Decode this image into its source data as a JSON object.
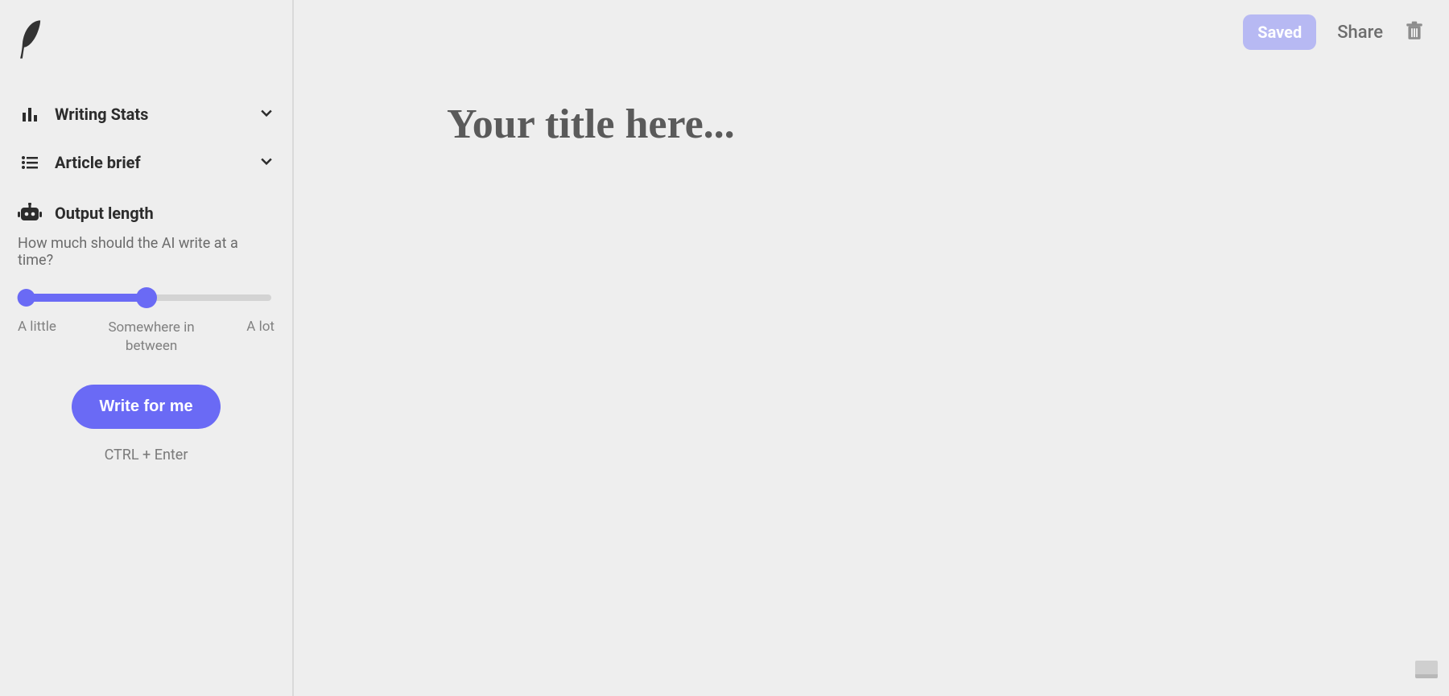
{
  "sidebar": {
    "sections": {
      "stats_label": "Writing Stats",
      "brief_label": "Article brief"
    },
    "output": {
      "title": "Output length",
      "subtitle": "How much should the AI write at a time?",
      "slider_value_percent": 50,
      "labels": {
        "min": "A little",
        "mid": "Somewhere in\nbetween",
        "max": "A lot"
      }
    },
    "write_button": "Write for me",
    "shortcut": "CTRL + Enter"
  },
  "topbar": {
    "saved": "Saved",
    "share": "Share"
  },
  "editor": {
    "title_placeholder": "Your title here...",
    "title_value": ""
  },
  "colors": {
    "accent": "#6a6af5"
  }
}
